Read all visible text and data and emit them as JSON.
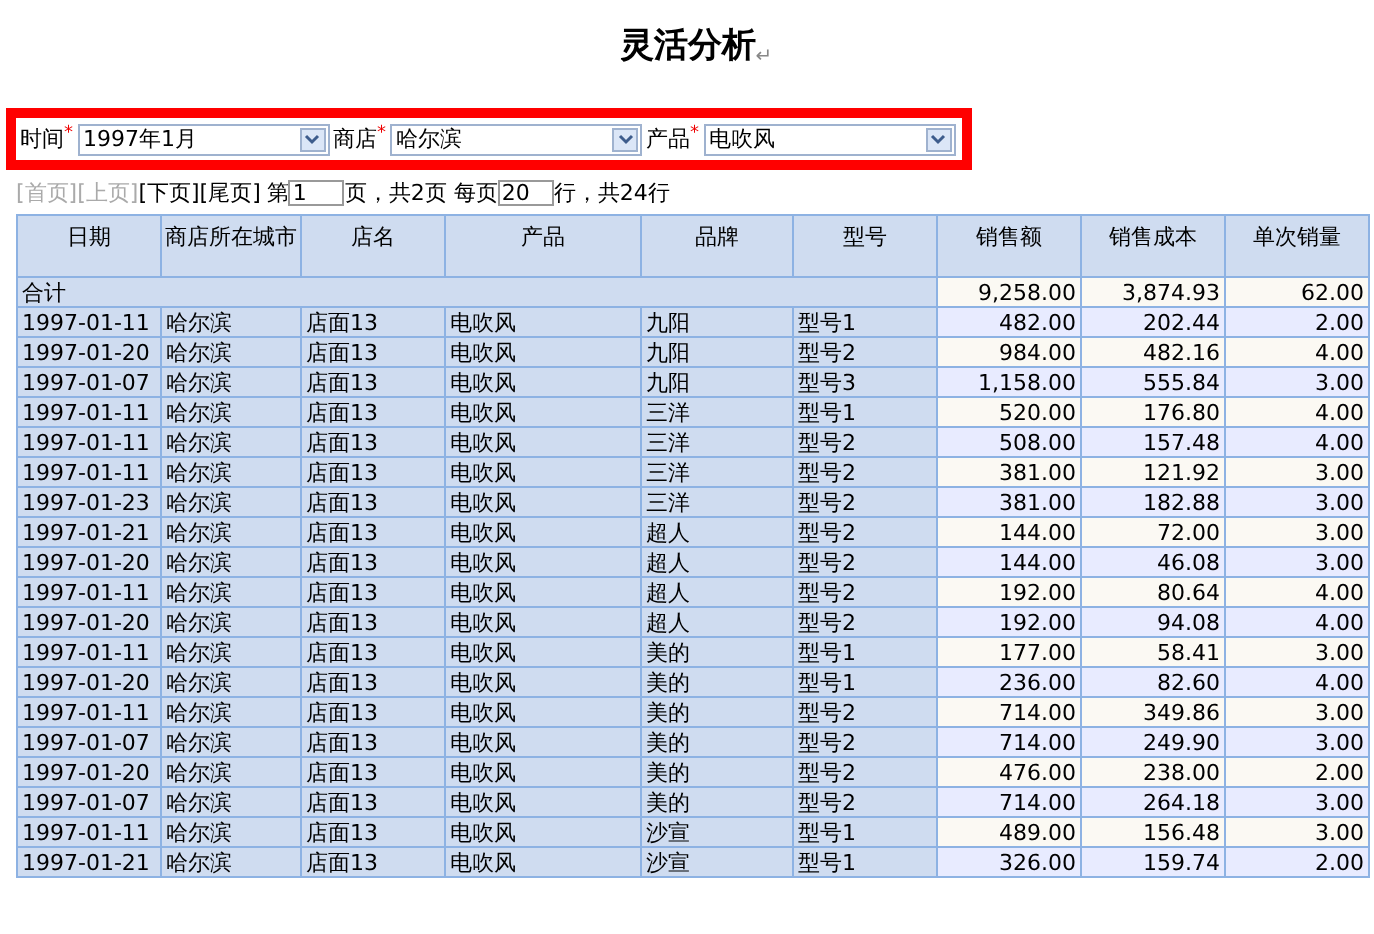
{
  "title": {
    "text": "灵活分析",
    "mark": "↵"
  },
  "filters": [
    {
      "label": "时间",
      "required_mark": "*",
      "value": "1997年1月"
    },
    {
      "label": "商店",
      "required_mark": "*",
      "value": "哈尔滨"
    },
    {
      "label": "产品",
      "required_mark": "*",
      "value": "电吹风"
    }
  ],
  "pager": {
    "links": [
      {
        "label": "[首页]",
        "disabled": true
      },
      {
        "label": "[上页]",
        "disabled": true
      },
      {
        "label": "[下页]",
        "disabled": false
      },
      {
        "label": "[尾页]",
        "disabled": false
      }
    ],
    "page_prefix": "第",
    "page_value": "1",
    "page_suffix": "页，共2页 每页",
    "size_value": "20",
    "size_suffix": "行，共24行"
  },
  "table": {
    "columns": [
      "日期",
      "商店所在城市",
      "店名",
      "产品",
      "品牌",
      "型号",
      "销售额",
      "销售成本",
      "单次销量"
    ],
    "total": {
      "label": "合计",
      "values": [
        "9,258.00",
        "3,874.93",
        "62.00"
      ]
    },
    "rows": [
      [
        "1997-01-11",
        "哈尔滨",
        "店面13",
        "电吹风",
        "九阳",
        "型号1",
        "482.00",
        "202.44",
        "2.00"
      ],
      [
        "1997-01-20",
        "哈尔滨",
        "店面13",
        "电吹风",
        "九阳",
        "型号2",
        "984.00",
        "482.16",
        "4.00"
      ],
      [
        "1997-01-07",
        "哈尔滨",
        "店面13",
        "电吹风",
        "九阳",
        "型号3",
        "1,158.00",
        "555.84",
        "3.00"
      ],
      [
        "1997-01-11",
        "哈尔滨",
        "店面13",
        "电吹风",
        "三洋",
        "型号1",
        "520.00",
        "176.80",
        "4.00"
      ],
      [
        "1997-01-11",
        "哈尔滨",
        "店面13",
        "电吹风",
        "三洋",
        "型号2",
        "508.00",
        "157.48",
        "4.00"
      ],
      [
        "1997-01-11",
        "哈尔滨",
        "店面13",
        "电吹风",
        "三洋",
        "型号2",
        "381.00",
        "121.92",
        "3.00"
      ],
      [
        "1997-01-23",
        "哈尔滨",
        "店面13",
        "电吹风",
        "三洋",
        "型号2",
        "381.00",
        "182.88",
        "3.00"
      ],
      [
        "1997-01-21",
        "哈尔滨",
        "店面13",
        "电吹风",
        "超人",
        "型号2",
        "144.00",
        "72.00",
        "3.00"
      ],
      [
        "1997-01-20",
        "哈尔滨",
        "店面13",
        "电吹风",
        "超人",
        "型号2",
        "144.00",
        "46.08",
        "3.00"
      ],
      [
        "1997-01-11",
        "哈尔滨",
        "店面13",
        "电吹风",
        "超人",
        "型号2",
        "192.00",
        "80.64",
        "4.00"
      ],
      [
        "1997-01-20",
        "哈尔滨",
        "店面13",
        "电吹风",
        "超人",
        "型号2",
        "192.00",
        "94.08",
        "4.00"
      ],
      [
        "1997-01-11",
        "哈尔滨",
        "店面13",
        "电吹风",
        "美的",
        "型号1",
        "177.00",
        "58.41",
        "3.00"
      ],
      [
        "1997-01-20",
        "哈尔滨",
        "店面13",
        "电吹风",
        "美的",
        "型号1",
        "236.00",
        "82.60",
        "4.00"
      ],
      [
        "1997-01-11",
        "哈尔滨",
        "店面13",
        "电吹风",
        "美的",
        "型号2",
        "714.00",
        "349.86",
        "3.00"
      ],
      [
        "1997-01-07",
        "哈尔滨",
        "店面13",
        "电吹风",
        "美的",
        "型号2",
        "714.00",
        "249.90",
        "3.00"
      ],
      [
        "1997-01-20",
        "哈尔滨",
        "店面13",
        "电吹风",
        "美的",
        "型号2",
        "476.00",
        "238.00",
        "2.00"
      ],
      [
        "1997-01-07",
        "哈尔滨",
        "店面13",
        "电吹风",
        "美的",
        "型号2",
        "714.00",
        "264.18",
        "3.00"
      ],
      [
        "1997-01-11",
        "哈尔滨",
        "店面13",
        "电吹风",
        "沙宣",
        "型号1",
        "489.00",
        "156.48",
        "3.00"
      ],
      [
        "1997-01-21",
        "哈尔滨",
        "店面13",
        "电吹风",
        "沙宣",
        "型号1",
        "326.00",
        "159.74",
        "2.00"
      ]
    ]
  }
}
